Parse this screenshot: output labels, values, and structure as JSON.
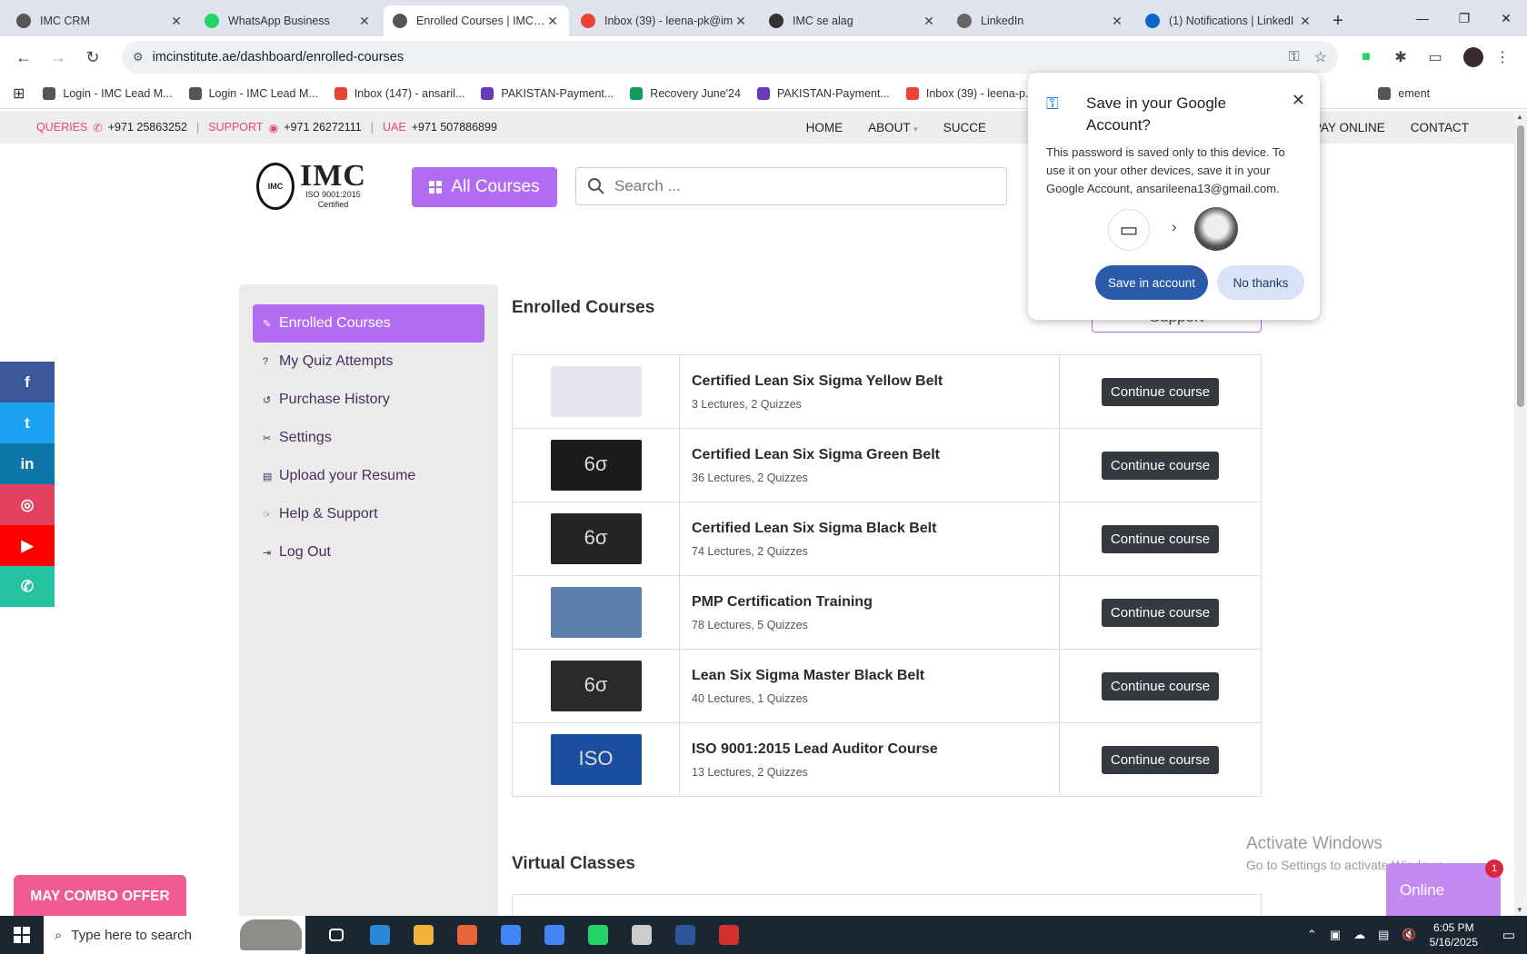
{
  "browser": {
    "tabs": [
      {
        "title": "IMC CRM",
        "color": "#555"
      },
      {
        "title": "WhatsApp Business",
        "color": "#25d366"
      },
      {
        "title": "Enrolled Courses | IMC Ce",
        "color": "#555",
        "active": true
      },
      {
        "title": "Inbox (39) - leena-pk@im",
        "color": "#ea4335"
      },
      {
        "title": "IMC se alag",
        "color": "#333"
      },
      {
        "title": "LinkedIn",
        "color": "#666"
      },
      {
        "title": "(1) Notifications | LinkedI",
        "color": "#0a66c2"
      }
    ],
    "url": "imcinstitute.ae/dashboard/enrolled-courses",
    "bookmarks": [
      {
        "label": "Login - IMC Lead M...",
        "color": "#555"
      },
      {
        "label": "Login - IMC Lead M...",
        "color": "#555"
      },
      {
        "label": "Inbox (147) - ansaril...",
        "color": "#ea4335"
      },
      {
        "label": "PAKISTAN-Payment...",
        "color": "#673ab7"
      },
      {
        "label": "Recovery June'24",
        "color": "#0f9d58"
      },
      {
        "label": "PAKISTAN-Payment...",
        "color": "#673ab7"
      },
      {
        "label": "Inbox (39) - leena-p...",
        "color": "#ea4335"
      },
      {
        "label": "ement",
        "color": "#555"
      }
    ]
  },
  "site": {
    "contact": {
      "queries_label": "QUERIES",
      "queries_num": "+971 25863252",
      "support_label": "SUPPORT",
      "support_num": "+971 26272111",
      "uae_label": "UAE",
      "uae_num": "+971 507886899"
    },
    "nav": [
      "HOME",
      "ABOUT",
      "SUCCE",
      "PAY ONLINE",
      "CONTACT"
    ],
    "logo": {
      "main": "IMC",
      "sub1": "ISO 9001:2015",
      "sub2": "Certified"
    },
    "all_courses_label": "All Courses",
    "search_placeholder": "Search ...",
    "sidebar": [
      {
        "label": "Enrolled Courses",
        "icon": "edit-icon",
        "active": true
      },
      {
        "label": "My Quiz Attempts",
        "icon": "question-icon"
      },
      {
        "label": "Purchase History",
        "icon": "history-icon"
      },
      {
        "label": "Settings",
        "icon": "tools-icon"
      },
      {
        "label": "Upload your Resume",
        "icon": "document-icon"
      },
      {
        "label": "Help & Support",
        "icon": "handshake-icon"
      },
      {
        "label": "Log Out",
        "icon": "logout-icon"
      }
    ],
    "main_title": "Enrolled Courses",
    "support_button": "Support",
    "courses": [
      {
        "title": "Certified Lean Six Sigma Yellow Belt",
        "meta": "3 Lectures, 2 Quizzes",
        "action": "Continue course",
        "thumb": "#e8e4ee",
        "mark": ""
      },
      {
        "title": "Certified Lean Six Sigma Green Belt",
        "meta": "36 Lectures, 2 Quizzes",
        "action": "Continue course",
        "thumb": "#1c1c1c",
        "mark": "6σ"
      },
      {
        "title": "Certified Lean Six Sigma Black Belt",
        "meta": "74 Lectures, 2 Quizzes",
        "action": "Continue course",
        "thumb": "#242424",
        "mark": "6σ"
      },
      {
        "title": "PMP Certification Training",
        "meta": "78 Lectures, 5 Quizzes",
        "action": "Continue course",
        "thumb": "#5c7fae",
        "mark": ""
      },
      {
        "title": "Lean Six Sigma Master Black Belt",
        "meta": "40 Lectures, 1 Quizzes",
        "action": "Continue course",
        "thumb": "#2a2a2a",
        "mark": "6σ"
      },
      {
        "title": "ISO 9001:2015 Lead Auditor Course",
        "meta": "13 Lectures, 2 Quizzes",
        "action": "Continue course",
        "thumb": "#1b4ea0",
        "mark": "ISO"
      }
    ],
    "virtual_title": "Virtual Classes",
    "combo_offer": "MAY COMBO OFFER",
    "online_label": "Online",
    "online_badge": "1",
    "social": [
      {
        "glyph": "f",
        "color": "#3b5998",
        "name": "facebook-icon"
      },
      {
        "glyph": "t",
        "color": "#1da1f2",
        "name": "twitter-icon"
      },
      {
        "glyph": "in",
        "color": "#0e76a8",
        "name": "linkedin-icon"
      },
      {
        "glyph": "◎",
        "color": "#e4405f",
        "name": "instagram-icon"
      },
      {
        "glyph": "▶",
        "color": "#ff0000",
        "name": "youtube-icon"
      },
      {
        "glyph": "✆",
        "color": "#25c2a0",
        "name": "whatsapp-icon"
      }
    ]
  },
  "activation": {
    "line1": "Activate Windows",
    "line2": "Go to Settings to activate Windows."
  },
  "password_popup": {
    "title": "Save in your Google Account?",
    "body": "This password is saved only to this device. To use it on your other devices, save it in your Google Account, ansarileena13@gmail.com.",
    "save_label": "Save in account",
    "no_label": "No thanks"
  },
  "taskbar": {
    "search_placeholder": "Type here to search",
    "time": "6:05 PM",
    "date": "5/16/2025",
    "apps": [
      "#ffffff",
      "#2b88d8",
      "#f2b33d",
      "#e8643b",
      "#4285f4",
      "#4285f4",
      "#25d366",
      "#cccccc",
      "#2b579a",
      "#d32f2f"
    ]
  }
}
